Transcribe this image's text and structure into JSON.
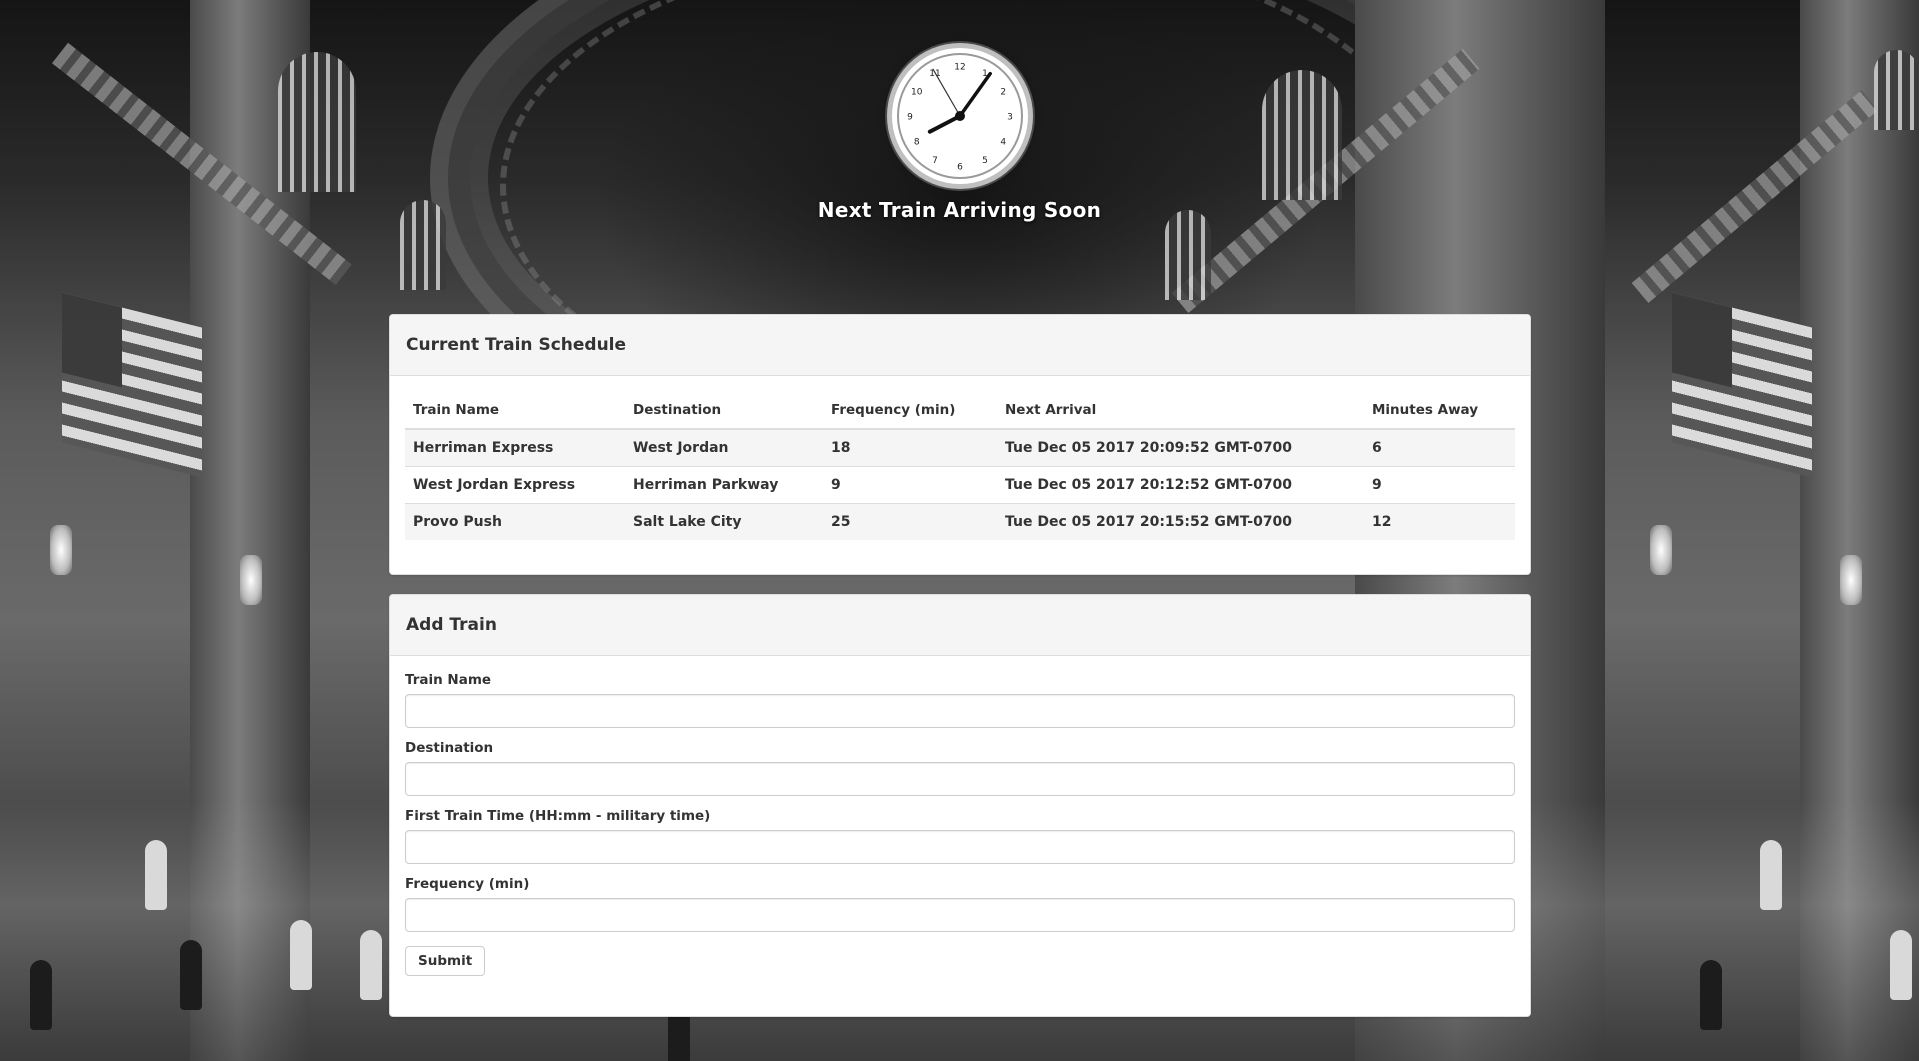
{
  "header": {
    "title": "Next Train Arriving Soon",
    "clock": {
      "numerals": [
        "12",
        "1",
        "2",
        "3",
        "4",
        "5",
        "6",
        "7",
        "8",
        "9",
        "10",
        "11"
      ],
      "hour": 8,
      "minute": 5,
      "second": 55
    }
  },
  "schedule": {
    "heading": "Current Train Schedule",
    "columns": [
      "Train Name",
      "Destination",
      "Frequency (min)",
      "Next Arrival",
      "Minutes Away"
    ],
    "rows": [
      [
        "Herriman Express",
        "West Jordan",
        "18",
        "Tue Dec 05 2017 20:09:52 GMT-0700",
        "6"
      ],
      [
        "West Jordan Express",
        "Herriman Parkway",
        "9",
        "Tue Dec 05 2017 20:12:52 GMT-0700",
        "9"
      ],
      [
        "Provo Push",
        "Salt Lake City",
        "25",
        "Tue Dec 05 2017 20:15:52 GMT-0700",
        "12"
      ]
    ]
  },
  "add_train": {
    "heading": "Add Train",
    "fields": {
      "train_name": {
        "label": "Train Name",
        "value": ""
      },
      "destination": {
        "label": "Destination",
        "value": ""
      },
      "first_time": {
        "label": "First Train Time (HH:mm - military time)",
        "value": ""
      },
      "frequency": {
        "label": "Frequency (min)",
        "value": ""
      }
    },
    "submit_label": "Submit"
  }
}
